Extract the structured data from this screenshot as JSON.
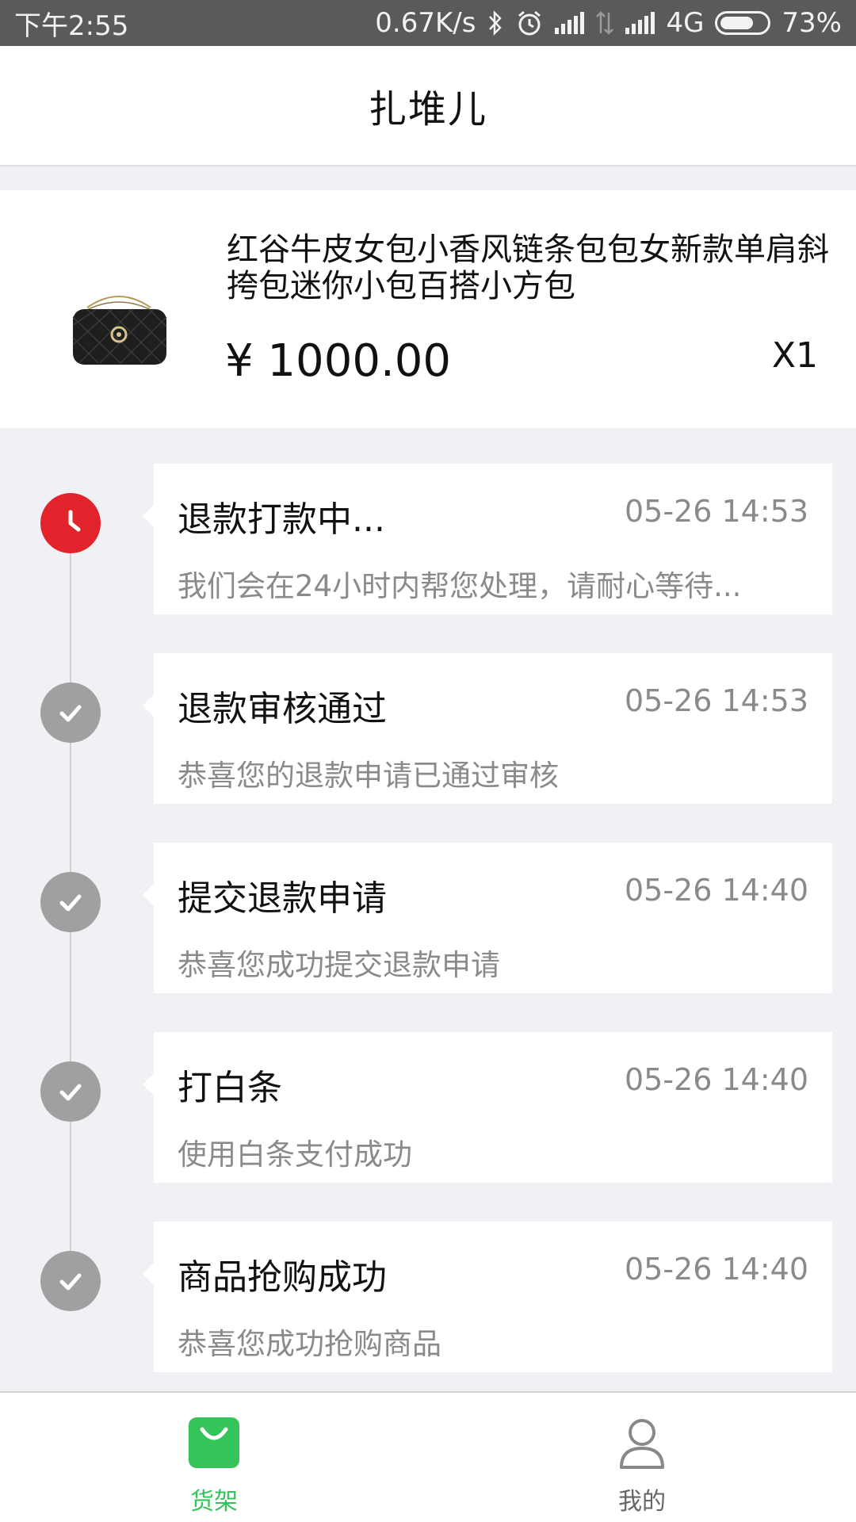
{
  "status_bar": {
    "time": "下午2:55",
    "net_speed": "0.67K/s",
    "network": "4G",
    "battery": "73%",
    "battery_level": 0.73
  },
  "header": {
    "title": "扎堆儿"
  },
  "product": {
    "name": "红谷牛皮女包小香风链条包包女新款单肩斜挎包迷你小包百搭小方包",
    "price": "¥ 1000.00",
    "quantity": "X1"
  },
  "timeline": [
    {
      "title": "退款打款中...",
      "time": "05-26 14:53",
      "desc": "我们会在24小时内帮您处理，请耐心等待...",
      "status": "active",
      "icon": "clock-icon"
    },
    {
      "title": "退款审核通过",
      "time": "05-26 14:53",
      "desc": "恭喜您的退款申请已通过审核",
      "status": "done",
      "icon": "check-icon"
    },
    {
      "title": "提交退款申请",
      "time": "05-26 14:40",
      "desc": "恭喜您成功提交退款申请",
      "status": "done",
      "icon": "check-icon"
    },
    {
      "title": "打白条",
      "time": "05-26 14:40",
      "desc": "使用白条支付成功",
      "status": "done",
      "icon": "check-icon"
    },
    {
      "title": "商品抢购成功",
      "time": "05-26 14:40",
      "desc": "恭喜您成功抢购商品",
      "status": "done",
      "icon": "check-icon"
    }
  ],
  "tabbar": {
    "tabs": [
      {
        "label": "货架",
        "icon": "shopping-bag-icon",
        "active": true
      },
      {
        "label": "我的",
        "icon": "user-icon",
        "active": false
      }
    ]
  },
  "colors": {
    "accent_green": "#35c459",
    "active_red": "#e3232c",
    "done_gray": "#a0a0a0",
    "background": "#f1f1f5"
  }
}
